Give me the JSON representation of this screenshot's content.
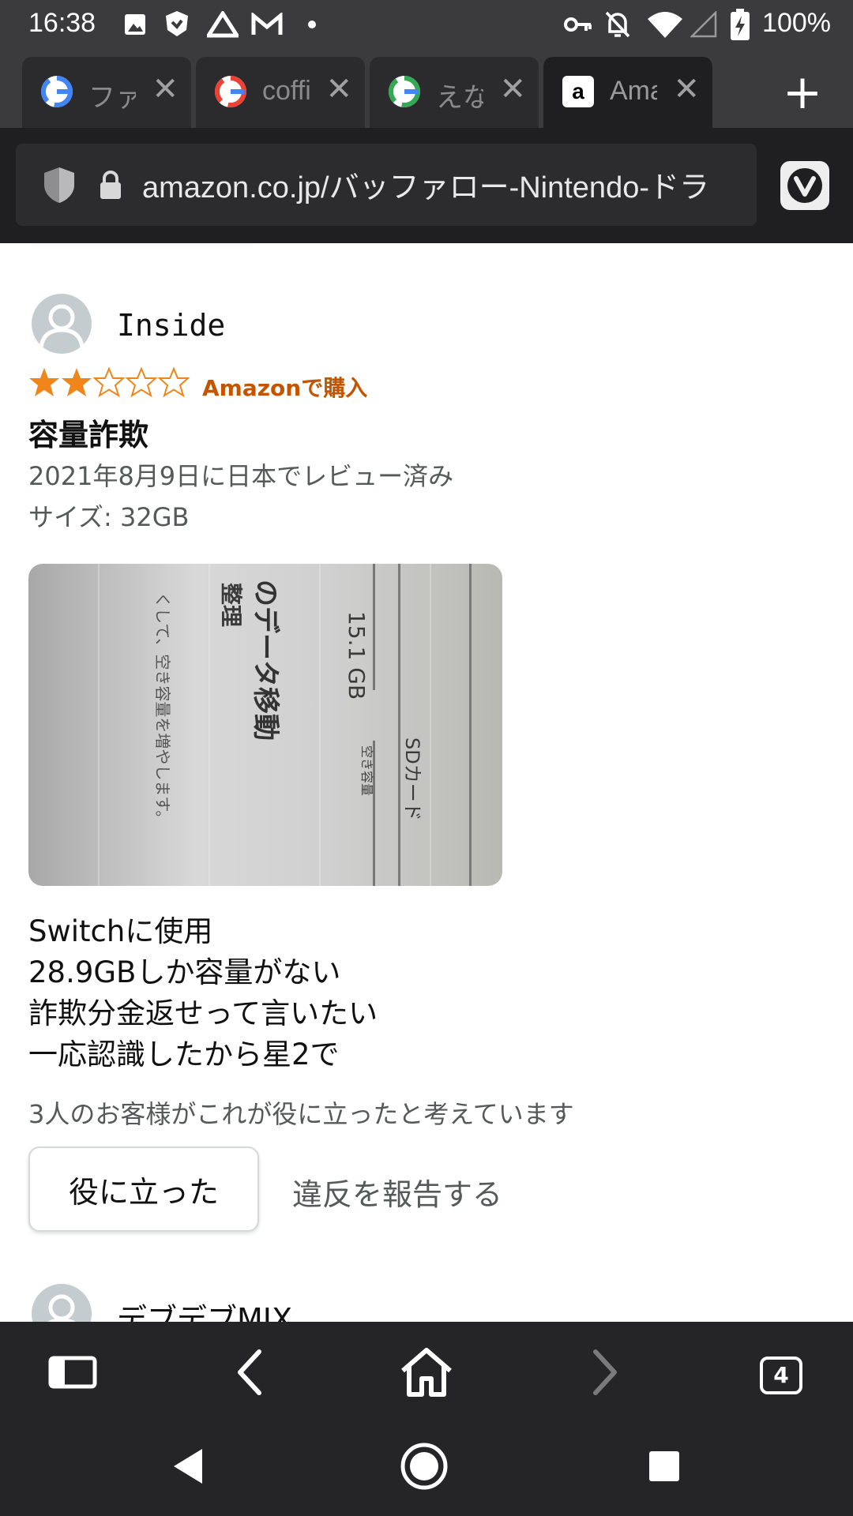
{
  "status_bar": {
    "time": "16:38",
    "battery": "100%",
    "left_icons": [
      "image-icon",
      "shield-app-icon",
      "drive-icon",
      "gmail-icon",
      "dot-icon"
    ],
    "right_icons": [
      "key-icon",
      "mute-icon",
      "wifi-icon",
      "signal-icon",
      "battery-charging-icon"
    ]
  },
  "tabs": [
    {
      "title": "ファ",
      "favicon": "google-icon",
      "active": false
    },
    {
      "title": "coffi",
      "favicon": "google-icon",
      "active": false
    },
    {
      "title": "えな",
      "favicon": "google-icon",
      "active": false
    },
    {
      "title": "Ama",
      "favicon": "amazon-icon",
      "active": true
    }
  ],
  "address_bar": {
    "url": "amazon.co.jp/バッファロー-Nintendo-ドラ"
  },
  "review": {
    "reviewer": "Inside",
    "rating": 2,
    "rating_max": 5,
    "verified_label": "Amazonで購入",
    "title": "容量詐欺",
    "date": "2021年8月9日に日本でレビュー済み",
    "size": "サイズ: 32GB",
    "image_texts": {
      "t1": "のデータ移動",
      "t2": "15.1 GB",
      "t3": "SDカード",
      "t4": "整理",
      "t5": "空き容量",
      "t6": "くして、空き容量を増やします。"
    },
    "body": "Switchに使用\n28.9GBしか容量がない\n詐欺分金返せって言いたい\n一応認識したから星2で",
    "helpful_count": "3人のお客様がこれが役に立ったと考えています",
    "helpful_button": "役に立った",
    "report_link": "違反を報告する"
  },
  "next_review": {
    "reviewer": "デブデブMIX"
  },
  "toolbar": {
    "tab_count": "4",
    "items": [
      "panel-icon",
      "back-icon",
      "home-icon",
      "forward-icon",
      "tab-switcher-icon"
    ]
  },
  "colors": {
    "star": "#f0861a",
    "verified": "#c45500",
    "chrome_dark": "#1f1f21"
  }
}
